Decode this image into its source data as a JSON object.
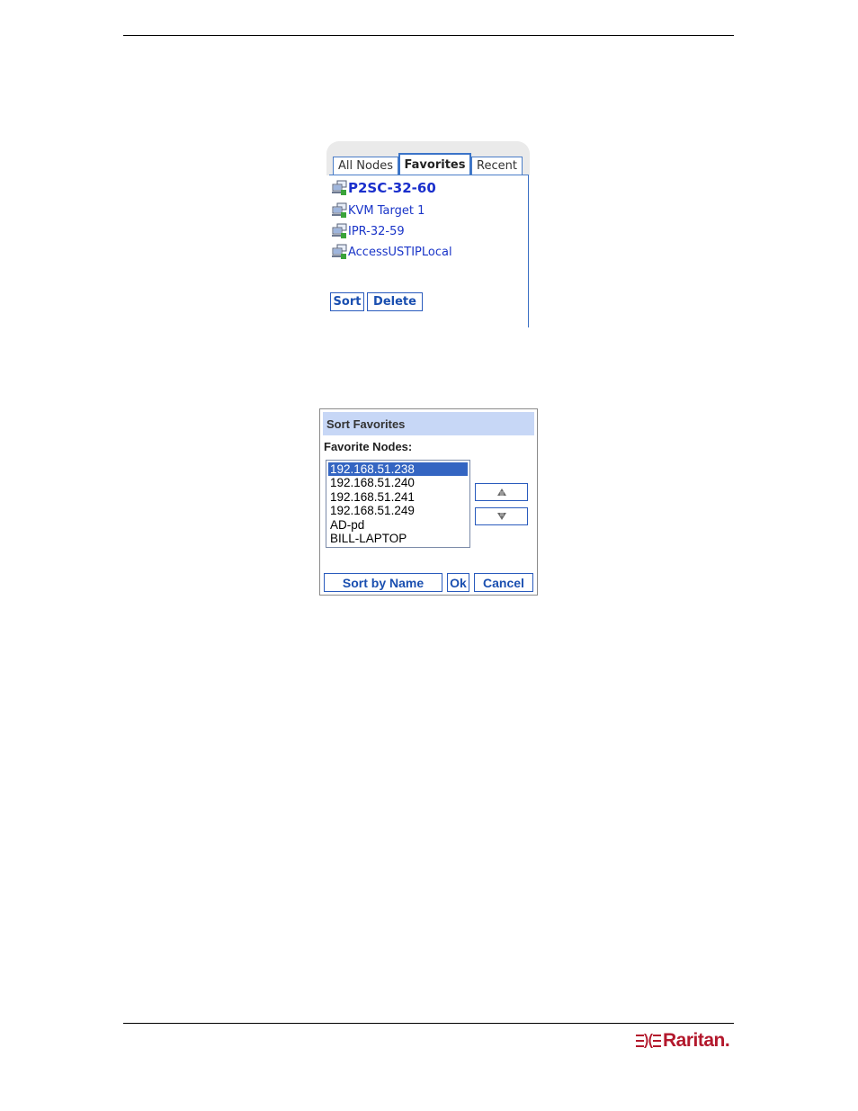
{
  "favorites_panel": {
    "tabs": [
      {
        "label": "All Nodes",
        "active": false
      },
      {
        "label": "Favorites",
        "active": true
      },
      {
        "label": "Recent",
        "active": false
      }
    ],
    "nodes": [
      {
        "label": "P2SC-32-60",
        "icon": "network-node-icon"
      },
      {
        "label": "KVM Target 1",
        "icon": "network-node-icon"
      },
      {
        "label": "IPR-32-59",
        "icon": "network-node-icon"
      },
      {
        "label": "AccessUSTIPLocal",
        "icon": "network-node-icon"
      }
    ],
    "sort_label": "Sort",
    "delete_label": "Delete"
  },
  "sort_dialog": {
    "title": "Sort Favorites",
    "list_label": "Favorite Nodes:",
    "items": [
      "192.168.51.238",
      "192.168.51.240",
      "192.168.51.241",
      "192.168.51.249",
      "AD-pd",
      "BILL-LAPTOP"
    ],
    "selected_index": 0,
    "move_up_icon": "arrow-up-icon",
    "move_down_icon": "arrow-down-icon",
    "sort_by_name_label": "Sort by Name",
    "ok_label": "Ok",
    "cancel_label": "Cancel"
  },
  "footer": {
    "logo_text": "Raritan",
    "logo_suffix": ".",
    "brand_color": "#b3182c"
  },
  "colors": {
    "link_blue": "#1a35c8",
    "button_border": "#2a5bbd",
    "dialog_title_bg": "#c7d7f6",
    "selection": "#3465c2"
  }
}
